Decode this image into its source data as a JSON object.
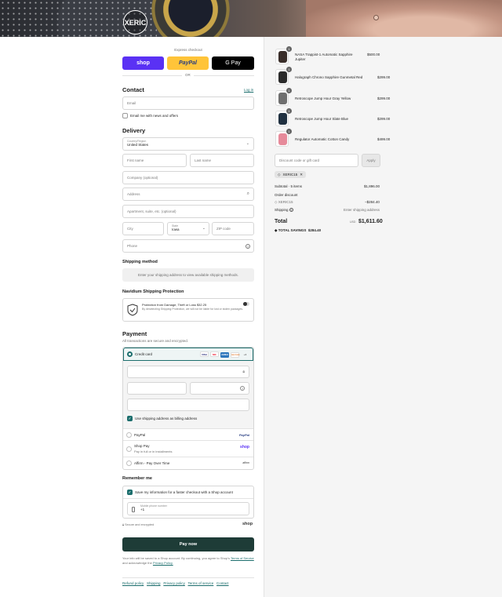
{
  "brand": {
    "logo_text": "XERIC"
  },
  "express": {
    "title": "Express checkout",
    "shop_label": "shop",
    "paypal_label": "PayPal",
    "gpay_label": "G Pay",
    "or_label": "OR",
    "colors": {
      "shop": "#5a31f4",
      "paypal": "#ffc439",
      "gpay": "#000000"
    }
  },
  "contact": {
    "heading": "Contact",
    "login_link": "Log in",
    "email_placeholder": "Email",
    "news_label": "Email me with news and offers"
  },
  "delivery": {
    "heading": "Delivery",
    "country_label": "Country/Region",
    "country_value": "United States",
    "first_name": "First name",
    "last_name": "Last name",
    "company": "Company (optional)",
    "address": "Address",
    "apartment": "Apartment, suite, etc. (optional)",
    "city": "City",
    "state_label": "State",
    "state_value": "Iowa",
    "zip": "ZIP code",
    "phone": "Phone"
  },
  "shipping": {
    "heading": "Shipping method",
    "message": "Enter your shipping address to view available shipping methods."
  },
  "protection": {
    "heading": "Navidium Shipping Protection",
    "line1": "Protection from Damage, Theft or Loss $32.25",
    "line2": "By deselecting Shipping Protection, we will not be liable for lost or stolen packages."
  },
  "payment": {
    "heading": "Payment",
    "subtitle": "All transactions are secure and encrypted.",
    "credit_card": "Credit card",
    "card_badges": [
      "VISA",
      "MC",
      "AMEX",
      "DISCOVER",
      "+4"
    ],
    "billing_same": "Use shipping address as billing address",
    "paypal": "PayPal",
    "paypal_logo": "PayPal",
    "shop_pay": "Shop Pay",
    "shop_pay_sub": "Pay in full or in installments",
    "shop_logo": "shop",
    "affirm": "Affirm - Pay Over Time",
    "affirm_logo": "affirm"
  },
  "remember": {
    "heading": "Remember me",
    "save_label": "Save my information for a faster checkout with a Shop account",
    "phone_label": "Mobile phone number",
    "phone_value": "+1",
    "secure": "Secure and encrypted",
    "shop_logo": "shop"
  },
  "pay_button": "Pay now",
  "legal": {
    "line1": "Your info will be saved to a Shop account. By continuing, you agree to Shop's",
    "terms": "Terms of Service",
    "and": "and acknowledge the",
    "privacy": "Privacy Policy."
  },
  "footer_links": [
    "Refund policy",
    "Shipping",
    "Privacy policy",
    "Terms of service",
    "Contact"
  ],
  "cart": {
    "items": [
      {
        "name": "NASA Trappist-1 Automatic Sapphire Jupiter",
        "price": "$500.00",
        "qty": "1",
        "color": "#3a2e2a"
      },
      {
        "name": "Halograph Chrono Sapphire Gunmetal Red",
        "price": "$299.00",
        "qty": "1",
        "color": "#2b2b2b"
      },
      {
        "name": "Retroscope Jump Hour Gray Yellow",
        "price": "$299.00",
        "qty": "1",
        "color": "#6f6f6f"
      },
      {
        "name": "Retroscope Jump Hour Slate Blue",
        "price": "$299.00",
        "qty": "1",
        "color": "#203040"
      },
      {
        "name": "Regulator Automatic Cotton Candy",
        "price": "$499.00",
        "qty": "1",
        "color": "#e68a9a"
      }
    ],
    "discount_placeholder": "Discount code or gift card",
    "apply": "Apply",
    "code_chip": "XERIC15",
    "subtotal_label": "Subtotal · 5 items",
    "subtotal_value": "$1,896.00",
    "order_discount_label": "Order discount",
    "discount_code": "XERIC15",
    "discount_value": "−$284.40",
    "shipping_label": "Shipping",
    "shipping_value": "Enter shipping address",
    "total_label": "Total",
    "currency": "USD",
    "total_value": "$1,611.60",
    "savings_label": "TOTAL SAVINGS",
    "savings_value": "$284.40"
  }
}
